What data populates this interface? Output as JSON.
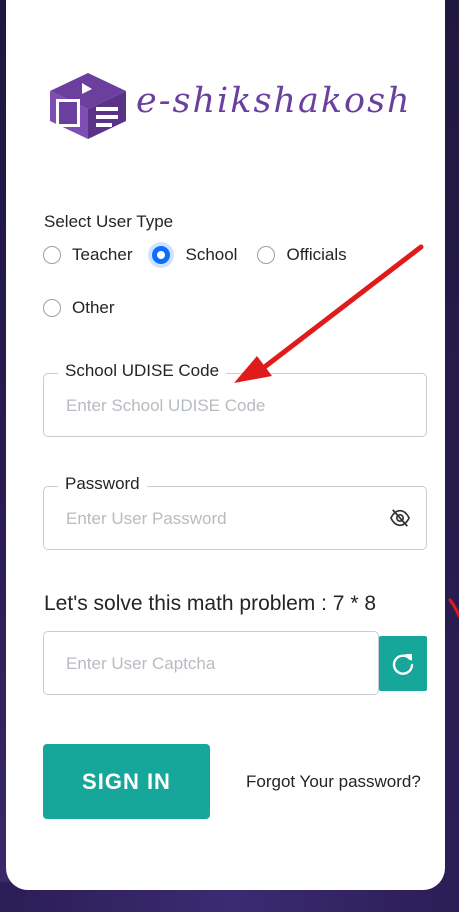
{
  "brand": {
    "name": "e-shikshakosh"
  },
  "user_type": {
    "label": "Select User Type",
    "options": [
      {
        "label": "Teacher",
        "checked": false
      },
      {
        "label": "School",
        "checked": true
      },
      {
        "label": "Officials",
        "checked": false
      },
      {
        "label": "Other",
        "checked": false
      }
    ]
  },
  "udise_field": {
    "label": "School UDISE Code",
    "placeholder": "Enter School UDISE Code",
    "value": ""
  },
  "password_field": {
    "label": "Password",
    "placeholder": "Enter User Password",
    "value": ""
  },
  "captcha": {
    "question": "Let's solve this math problem : 7 * 8",
    "placeholder": "Enter User Captcha",
    "value": ""
  },
  "actions": {
    "sign_in_label": "SIGN IN",
    "forgot_label": "Forgot Your password?"
  },
  "colors": {
    "accent": "#16a79a",
    "brand": "#6b3f9d",
    "radio_checked": "#0d6efd",
    "annotation": "#e01b1b"
  }
}
